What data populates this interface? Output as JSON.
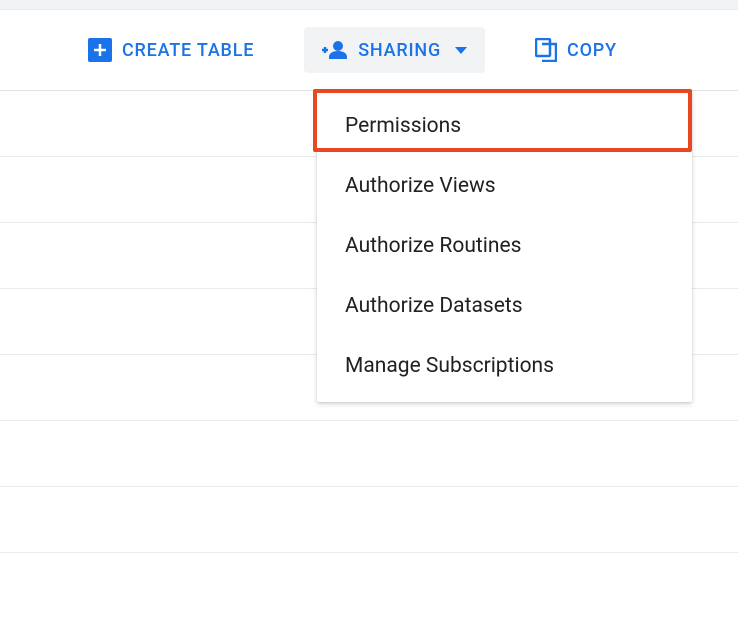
{
  "toolbar": {
    "create_table_label": "CREATE TABLE",
    "sharing_label": "SHARING",
    "copy_label": "COPY"
  },
  "sharing_menu": {
    "items": [
      {
        "label": "Permissions"
      },
      {
        "label": "Authorize Views"
      },
      {
        "label": "Authorize Routines"
      },
      {
        "label": "Authorize Datasets"
      },
      {
        "label": "Manage Subscriptions"
      }
    ]
  }
}
